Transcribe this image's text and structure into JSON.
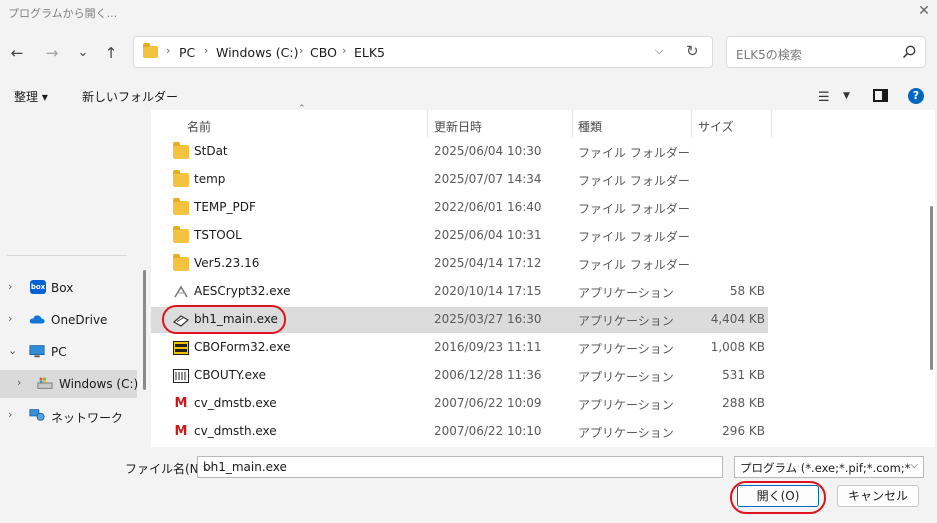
{
  "window": {
    "title": "プログラムから開く...",
    "close_glyph": "✕"
  },
  "nav": {
    "back": "←",
    "forward": "→",
    "recent": "⌄",
    "up": "↑"
  },
  "address": {
    "crumbs": [
      "PC",
      "Windows (C:)",
      "CBO",
      "ELK5"
    ],
    "separator": "›",
    "dropdown": "⌵",
    "refresh": "↻"
  },
  "search": {
    "placeholder": "ELK5の検索"
  },
  "toolbar": {
    "organize": "整理 ▾",
    "new_folder": "新しいフォルダー",
    "help": "?"
  },
  "sidebar": {
    "items": [
      {
        "label": "Box",
        "chevron": "›",
        "icon": "box-icon"
      },
      {
        "label": "OneDrive",
        "chevron": "›",
        "icon": "onedrive-icon"
      },
      {
        "label": "PC",
        "chevron": "⌄",
        "icon": "pc-icon"
      },
      {
        "label": "Windows (C:)",
        "chevron": "›",
        "icon": "drive-icon"
      },
      {
        "label": "ネットワーク",
        "chevron": "›",
        "icon": "network-icon"
      }
    ]
  },
  "columns": {
    "name": "名前",
    "date": "更新日時",
    "type": "種類",
    "size": "サイズ"
  },
  "files": [
    {
      "name": "StDat",
      "date": "2025/06/04 10:30",
      "type": "ファイル フォルダー",
      "size": "",
      "icon": "folder"
    },
    {
      "name": "temp",
      "date": "2025/07/07 14:34",
      "type": "ファイル フォルダー",
      "size": "",
      "icon": "folder"
    },
    {
      "name": "TEMP_PDF",
      "date": "2022/06/01 16:40",
      "type": "ファイル フォルダー",
      "size": "",
      "icon": "folder"
    },
    {
      "name": "TSTOOL",
      "date": "2025/06/04 10:31",
      "type": "ファイル フォルダー",
      "size": "",
      "icon": "folder"
    },
    {
      "name": "Ver5.23.16",
      "date": "2025/04/14 17:12",
      "type": "ファイル フォルダー",
      "size": "",
      "icon": "folder"
    },
    {
      "name": "AESCrypt32.exe",
      "date": "2020/10/14 17:15",
      "type": "アプリケーション",
      "size": "58 KB",
      "icon": "exe"
    },
    {
      "name": "bh1_main.exe",
      "date": "2025/03/27 16:30",
      "type": "アプリケーション",
      "size": "4,404 KB",
      "icon": "exe",
      "selected": true
    },
    {
      "name": "CBOForm32.exe",
      "date": "2016/09/23 11:11",
      "type": "アプリケーション",
      "size": "1,008 KB",
      "icon": "exe"
    },
    {
      "name": "CBOUTY.exe",
      "date": "2006/12/28 11:36",
      "type": "アプリケーション",
      "size": "531 KB",
      "icon": "exe"
    },
    {
      "name": "cv_dmstb.exe",
      "date": "2007/06/22 10:09",
      "type": "アプリケーション",
      "size": "288 KB",
      "icon": "m"
    },
    {
      "name": "cv_dmsth.exe",
      "date": "2007/06/22 10:10",
      "type": "アプリケーション",
      "size": "296 KB",
      "icon": "m"
    }
  ],
  "footer": {
    "filename_label": "ファイル名(N):",
    "filename_value": "bh1_main.exe",
    "filter": "プログラム (*.exe;*.pif;*.com;*.bat",
    "dropdown": "⌵",
    "open": "開く(O)",
    "cancel": "キャンセル"
  },
  "colors": {
    "accent": "#0067c0",
    "highlight_ring": "#e0141e",
    "folder": "#f3c33f"
  }
}
